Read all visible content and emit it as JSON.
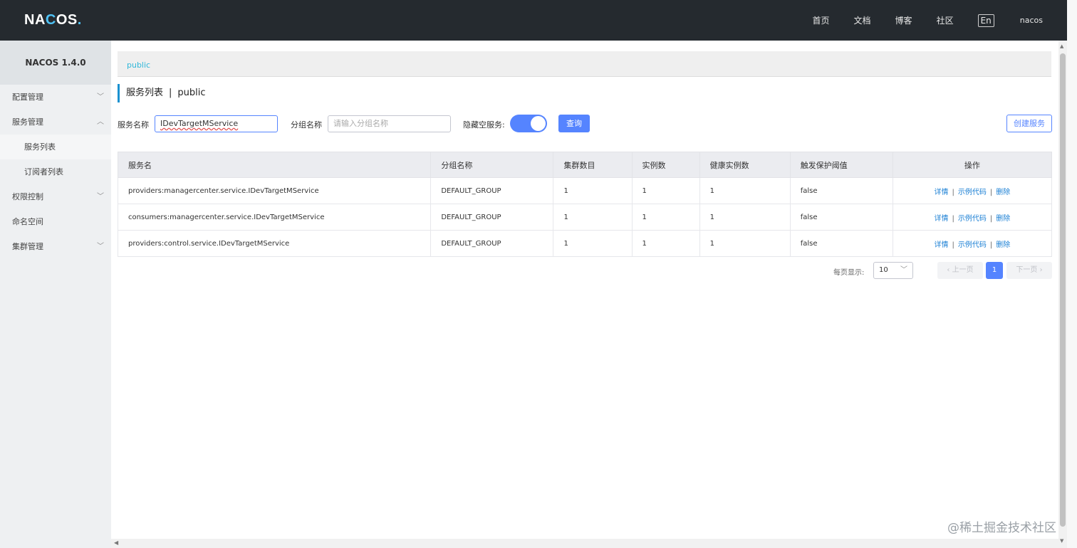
{
  "header": {
    "logo_prefix": "NA",
    "logo_mid": "C",
    "logo_suffix": "OS",
    "logo_dot": ".",
    "nav": [
      "首页",
      "文档",
      "博客",
      "社区"
    ],
    "lang": "En",
    "user": "nacos"
  },
  "sidebar": {
    "version": "NACOS 1.4.0",
    "items": [
      {
        "label": "配置管理",
        "icon": "chevron-down-icon"
      },
      {
        "label": "服务管理",
        "icon": "chevron-up-icon"
      },
      {
        "label": "服务列表"
      },
      {
        "label": "订阅者列表"
      },
      {
        "label": "权限控制",
        "icon": "chevron-down-icon"
      },
      {
        "label": "命名空间"
      },
      {
        "label": "集群管理",
        "icon": "chevron-down-icon"
      }
    ]
  },
  "namespace": {
    "tab": "public"
  },
  "page": {
    "title": "服务列表",
    "sep": "|",
    "namespace": "public"
  },
  "filters": {
    "service_name_label": "服务名称",
    "service_name_value": "IDevTargetMService",
    "group_name_label": "分组名称",
    "group_name_placeholder": "请输入分组名称",
    "hide_empty_label": "隐藏空服务:",
    "hide_empty_on": true,
    "query_button": "查询",
    "create_button": "创建服务"
  },
  "table": {
    "headers": [
      "服务名",
      "分组名称",
      "集群数目",
      "实例数",
      "健康实例数",
      "触发保护阈值",
      "操作"
    ],
    "rows": [
      [
        "providers:managercenter.service.IDevTargetMService",
        "DEFAULT_GROUP",
        "1",
        "1",
        "1",
        "false"
      ],
      [
        "consumers:managercenter.service.IDevTargetMService",
        "DEFAULT_GROUP",
        "1",
        "1",
        "1",
        "false"
      ],
      [
        "providers:control.service.IDevTargetMService",
        "DEFAULT_GROUP",
        "1",
        "1",
        "1",
        "false"
      ]
    ],
    "ops": {
      "detail": "详情",
      "sample": "示例代码",
      "delete": "删除",
      "sep": "|"
    }
  },
  "pagination": {
    "page_size_label": "每页显示:",
    "page_size": "10",
    "prev": "上一页",
    "current": "1",
    "next": "下一页"
  },
  "watermark": "@稀土掘金技术社区",
  "colors": {
    "header_bg": "#252a2f",
    "primary": "#5584ff",
    "link": "#1a7fd4",
    "ns_tab": "#2fb7d9"
  }
}
